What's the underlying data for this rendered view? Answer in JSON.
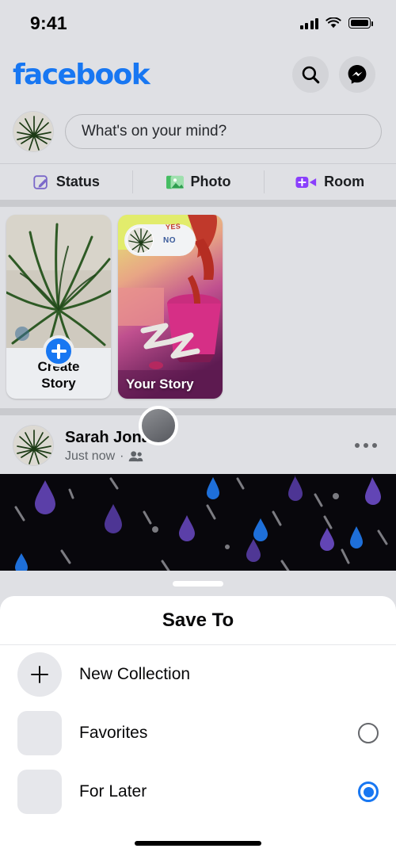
{
  "status_bar": {
    "time": "9:41",
    "signal_icon": "signal-bars-icon",
    "wifi_icon": "wifi-icon",
    "battery_icon": "battery-icon"
  },
  "header": {
    "logo": "facebook",
    "search_icon": "search-icon",
    "messenger_icon": "messenger-icon",
    "brand_color": "#1877f2"
  },
  "composer": {
    "avatar_icon": "user-avatar",
    "placeholder": "What's on your mind?",
    "actions": [
      {
        "label": "Status",
        "icon": "pencil-square-icon",
        "color": "#7b68c9"
      },
      {
        "label": "Photo",
        "icon": "photo-icon",
        "color": "#45bd62"
      },
      {
        "label": "Room",
        "icon": "video-plus-icon",
        "color": "#8a3ffc"
      }
    ]
  },
  "stories": [
    {
      "type": "create",
      "label_line1": "Create",
      "label_line2": "Story",
      "plus_icon": "plus-icon"
    },
    {
      "type": "mine",
      "label": "Your Story",
      "sticker_yes": "YES",
      "sticker_no": "NO"
    }
  ],
  "post": {
    "author": "Sarah Jonas",
    "timestamp": "Just now",
    "audience_icon": "friends-icon",
    "menu_icon": "more-options-icon",
    "separator": "·"
  },
  "sheet": {
    "grabber_icon": "drag-handle-icon",
    "title": "Save To",
    "rows": [
      {
        "label": "New Collection",
        "icon": "plus-icon",
        "control": "none"
      },
      {
        "label": "Favorites",
        "icon": "collection-thumb",
        "control": "radio",
        "selected": false
      },
      {
        "label": "For Later",
        "icon": "collection-thumb",
        "control": "radio",
        "selected": true
      }
    ],
    "selected_color": "#1877f2"
  },
  "home_indicator": "home-indicator"
}
